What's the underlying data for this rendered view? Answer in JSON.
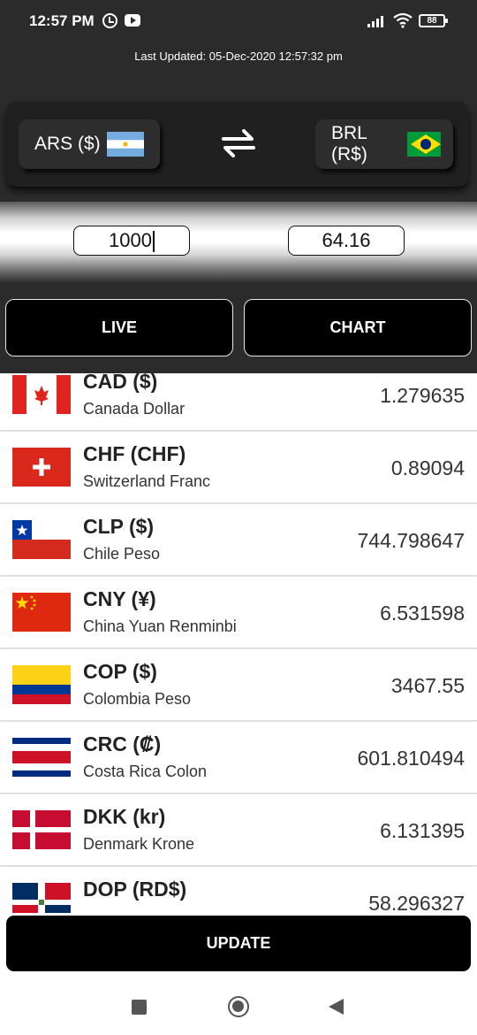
{
  "status_bar": {
    "time": "12:57 PM",
    "battery": "88",
    "icons": [
      "alarm-icon",
      "youtube-icon",
      "signal-icon",
      "wifi-icon",
      "battery-icon"
    ]
  },
  "header": {
    "last_updated": "Last Updated: 05-Dec-2020 12:57:32 pm"
  },
  "selector": {
    "from_label": "ARS ($)",
    "from_flag": "argentina-flag",
    "to_label": "BRL (R$)",
    "to_flag": "brazil-flag",
    "swap_icon": "swap-arrows-icon"
  },
  "converter": {
    "from_amount": "1000",
    "to_amount": "64.16"
  },
  "tabs": [
    {
      "label": "LIVE"
    },
    {
      "label": "CHART"
    }
  ],
  "rates": [
    {
      "code": "CAD ($)",
      "name": "Canada Dollar",
      "value": "1.279635",
      "flag": "canada-flag"
    },
    {
      "code": "CHF (CHF)",
      "name": "Switzerland Franc",
      "value": "0.89094",
      "flag": "switzerland-flag"
    },
    {
      "code": "CLP ($)",
      "name": "Chile Peso",
      "value": "744.798647",
      "flag": "chile-flag"
    },
    {
      "code": "CNY (¥)",
      "name": "China Yuan Renminbi",
      "value": "6.531598",
      "flag": "china-flag"
    },
    {
      "code": "COP ($)",
      "name": "Colombia Peso",
      "value": "3467.55",
      "flag": "colombia-flag"
    },
    {
      "code": "CRC (₡)",
      "name": "Costa Rica Colon",
      "value": "601.810494",
      "flag": "costa-rica-flag"
    },
    {
      "code": "DKK (kr)",
      "name": "Denmark Krone",
      "value": "6.131395",
      "flag": "denmark-flag"
    },
    {
      "code": "DOP (RD$)",
      "name": "",
      "value": "58.296327",
      "flag": "dominican-republic-flag"
    }
  ],
  "update_button": {
    "label": "UPDATE"
  },
  "nav": [
    "recent-apps-icon",
    "home-icon",
    "back-icon"
  ],
  "colors": {
    "dark_bg": "#2b2b2b",
    "button_bg": "#000000",
    "row_bg": "#ffffff"
  }
}
